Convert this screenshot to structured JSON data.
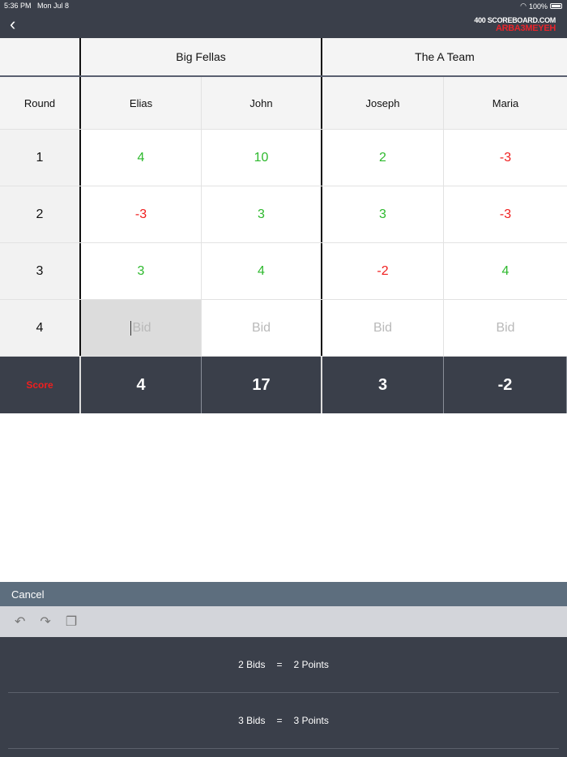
{
  "status": {
    "time": "5:36 PM",
    "date": "Mon Jul 8",
    "battery": "100%"
  },
  "header": {
    "brand_line1": "400 SCOREBOARD.COM",
    "brand_line2": "ARBA3MEYEH"
  },
  "teams": [
    "Big Fellas",
    "The A Team"
  ],
  "columns": {
    "round": "Round",
    "players": [
      "Elias",
      "John",
      "Joseph",
      "Maria"
    ]
  },
  "rounds": [
    {
      "n": "1",
      "v": [
        "4",
        "10",
        "2",
        "-3"
      ]
    },
    {
      "n": "2",
      "v": [
        "-3",
        "3",
        "3",
        "-3"
      ]
    },
    {
      "n": "3",
      "v": [
        "3",
        "4",
        "-2",
        "4"
      ]
    },
    {
      "n": "4",
      "v": [
        "Bid",
        "Bid",
        "Bid",
        "Bid"
      ]
    }
  ],
  "score": {
    "label": "Score",
    "v": [
      "4",
      "17",
      "3",
      "-2"
    ]
  },
  "keyboard": {
    "cancel": "Cancel",
    "options": [
      {
        "bids": "2 Bids",
        "eq": "=",
        "points": "2 Points"
      },
      {
        "bids": "3 Bids",
        "eq": "=",
        "points": "3 Points"
      }
    ]
  },
  "colors": {
    "positive": "#2db92d",
    "negative": "#f01e1e",
    "header": "#3a3f4a"
  }
}
